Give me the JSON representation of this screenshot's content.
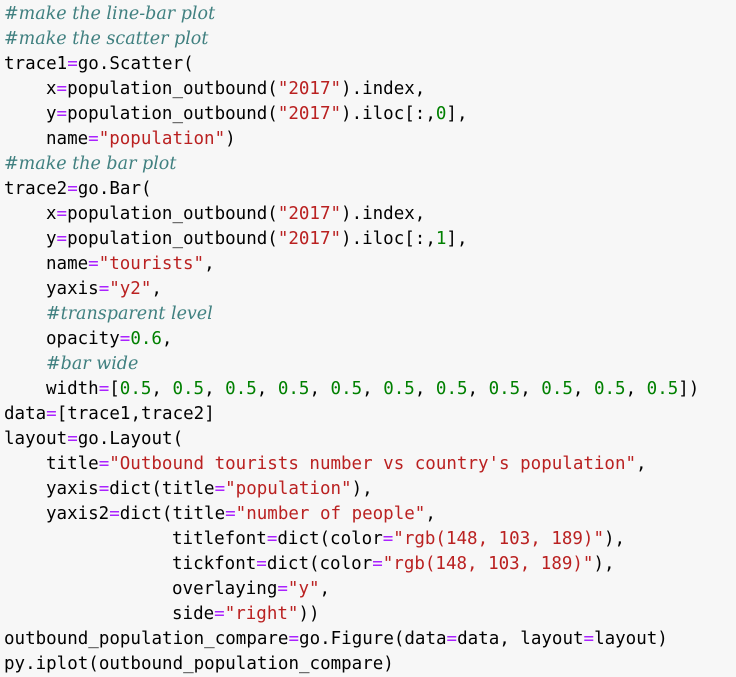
{
  "code_lines": [
    {
      "indent": 0,
      "parts": [
        {
          "t": "c",
          "v": "#make the line-bar plot"
        }
      ]
    },
    {
      "indent": 0,
      "parts": [
        {
          "t": "c",
          "v": "#make the scatter plot"
        }
      ]
    },
    {
      "indent": 0,
      "parts": [
        {
          "t": "k",
          "v": "trace1"
        },
        {
          "t": "o",
          "v": "="
        },
        {
          "t": "k",
          "v": "go.Scatter("
        }
      ]
    },
    {
      "indent": 1,
      "parts": [
        {
          "t": "k",
          "v": "x"
        },
        {
          "t": "o",
          "v": "="
        },
        {
          "t": "k",
          "v": "population_outbound("
        },
        {
          "t": "s",
          "v": "\"2017\""
        },
        {
          "t": "k",
          "v": ").index,"
        }
      ]
    },
    {
      "indent": 1,
      "parts": [
        {
          "t": "k",
          "v": "y"
        },
        {
          "t": "o",
          "v": "="
        },
        {
          "t": "k",
          "v": "population_outbound("
        },
        {
          "t": "s",
          "v": "\"2017\""
        },
        {
          "t": "k",
          "v": ").iloc[:,"
        },
        {
          "t": "n",
          "v": "0"
        },
        {
          "t": "k",
          "v": "],"
        }
      ]
    },
    {
      "indent": 1,
      "parts": [
        {
          "t": "k",
          "v": "name"
        },
        {
          "t": "o",
          "v": "="
        },
        {
          "t": "s",
          "v": "\"population\""
        },
        {
          "t": "k",
          "v": ")"
        }
      ]
    },
    {
      "indent": 0,
      "parts": [
        {
          "t": "c",
          "v": "#make the bar plot"
        }
      ]
    },
    {
      "indent": 0,
      "parts": [
        {
          "t": "k",
          "v": "trace2"
        },
        {
          "t": "o",
          "v": "="
        },
        {
          "t": "k",
          "v": "go.Bar("
        }
      ]
    },
    {
      "indent": 1,
      "parts": [
        {
          "t": "k",
          "v": "x"
        },
        {
          "t": "o",
          "v": "="
        },
        {
          "t": "k",
          "v": "population_outbound("
        },
        {
          "t": "s",
          "v": "\"2017\""
        },
        {
          "t": "k",
          "v": ").index,"
        }
      ]
    },
    {
      "indent": 1,
      "parts": [
        {
          "t": "k",
          "v": "y"
        },
        {
          "t": "o",
          "v": "="
        },
        {
          "t": "k",
          "v": "population_outbound("
        },
        {
          "t": "s",
          "v": "\"2017\""
        },
        {
          "t": "k",
          "v": ").iloc[:,"
        },
        {
          "t": "n",
          "v": "1"
        },
        {
          "t": "k",
          "v": "],"
        }
      ]
    },
    {
      "indent": 1,
      "parts": [
        {
          "t": "k",
          "v": "name"
        },
        {
          "t": "o",
          "v": "="
        },
        {
          "t": "s",
          "v": "\"tourists\""
        },
        {
          "t": "k",
          "v": ","
        }
      ]
    },
    {
      "indent": 1,
      "parts": [
        {
          "t": "k",
          "v": "yaxis"
        },
        {
          "t": "o",
          "v": "="
        },
        {
          "t": "s",
          "v": "\"y2\""
        },
        {
          "t": "k",
          "v": ","
        }
      ]
    },
    {
      "indent": 1,
      "parts": [
        {
          "t": "c",
          "v": "#transparent level"
        }
      ]
    },
    {
      "indent": 1,
      "parts": [
        {
          "t": "k",
          "v": "opacity"
        },
        {
          "t": "o",
          "v": "="
        },
        {
          "t": "n",
          "v": "0.6"
        },
        {
          "t": "k",
          "v": ","
        }
      ]
    },
    {
      "indent": 1,
      "parts": [
        {
          "t": "c",
          "v": "#bar wide"
        }
      ]
    },
    {
      "indent": 1,
      "parts": [
        {
          "t": "k",
          "v": "width"
        },
        {
          "t": "o",
          "v": "="
        },
        {
          "t": "k",
          "v": "["
        },
        {
          "t": "n",
          "v": "0.5"
        },
        {
          "t": "k",
          "v": ", "
        },
        {
          "t": "n",
          "v": "0.5"
        },
        {
          "t": "k",
          "v": ", "
        },
        {
          "t": "n",
          "v": "0.5"
        },
        {
          "t": "k",
          "v": ", "
        },
        {
          "t": "n",
          "v": "0.5"
        },
        {
          "t": "k",
          "v": ", "
        },
        {
          "t": "n",
          "v": "0.5"
        },
        {
          "t": "k",
          "v": ", "
        },
        {
          "t": "n",
          "v": "0.5"
        },
        {
          "t": "k",
          "v": ", "
        },
        {
          "t": "n",
          "v": "0.5"
        },
        {
          "t": "k",
          "v": ", "
        },
        {
          "t": "n",
          "v": "0.5"
        },
        {
          "t": "k",
          "v": ", "
        },
        {
          "t": "n",
          "v": "0.5"
        },
        {
          "t": "k",
          "v": ", "
        },
        {
          "t": "n",
          "v": "0.5"
        },
        {
          "t": "k",
          "v": ", "
        },
        {
          "t": "n",
          "v": "0.5"
        },
        {
          "t": "k",
          "v": "])"
        }
      ]
    },
    {
      "indent": 0,
      "parts": [
        {
          "t": "k",
          "v": "data"
        },
        {
          "t": "o",
          "v": "="
        },
        {
          "t": "k",
          "v": "[trace1,trace2]"
        }
      ]
    },
    {
      "indent": 0,
      "parts": [
        {
          "t": "k",
          "v": "layout"
        },
        {
          "t": "o",
          "v": "="
        },
        {
          "t": "k",
          "v": "go.Layout("
        }
      ]
    },
    {
      "indent": 1,
      "parts": [
        {
          "t": "k",
          "v": "title"
        },
        {
          "t": "o",
          "v": "="
        },
        {
          "t": "s",
          "v": "\"Outbound tourists number vs country's population\""
        },
        {
          "t": "k",
          "v": ","
        }
      ]
    },
    {
      "indent": 1,
      "parts": [
        {
          "t": "k",
          "v": "yaxis"
        },
        {
          "t": "o",
          "v": "="
        },
        {
          "t": "k",
          "v": "dict(title"
        },
        {
          "t": "o",
          "v": "="
        },
        {
          "t": "s",
          "v": "\"population\""
        },
        {
          "t": "k",
          "v": "),"
        }
      ]
    },
    {
      "indent": 1,
      "parts": [
        {
          "t": "k",
          "v": "yaxis2"
        },
        {
          "t": "o",
          "v": "="
        },
        {
          "t": "k",
          "v": "dict(title"
        },
        {
          "t": "o",
          "v": "="
        },
        {
          "t": "s",
          "v": "\"number of people\""
        },
        {
          "t": "k",
          "v": ","
        }
      ]
    },
    {
      "indent": 2,
      "parts": [
        {
          "t": "k",
          "v": "titlefont"
        },
        {
          "t": "o",
          "v": "="
        },
        {
          "t": "k",
          "v": "dict(color"
        },
        {
          "t": "o",
          "v": "="
        },
        {
          "t": "s",
          "v": "\"rgb(148, 103, 189)\""
        },
        {
          "t": "k",
          "v": "),"
        }
      ]
    },
    {
      "indent": 2,
      "parts": [
        {
          "t": "k",
          "v": "tickfont"
        },
        {
          "t": "o",
          "v": "="
        },
        {
          "t": "k",
          "v": "dict(color"
        },
        {
          "t": "o",
          "v": "="
        },
        {
          "t": "s",
          "v": "\"rgb(148, 103, 189)\""
        },
        {
          "t": "k",
          "v": "),"
        }
      ]
    },
    {
      "indent": 2,
      "parts": [
        {
          "t": "k",
          "v": "overlaying"
        },
        {
          "t": "o",
          "v": "="
        },
        {
          "t": "s",
          "v": "\"y\""
        },
        {
          "t": "k",
          "v": ","
        }
      ]
    },
    {
      "indent": 2,
      "parts": [
        {
          "t": "k",
          "v": "side"
        },
        {
          "t": "o",
          "v": "="
        },
        {
          "t": "s",
          "v": "\"right\""
        },
        {
          "t": "k",
          "v": "))"
        }
      ]
    },
    {
      "indent": 0,
      "parts": [
        {
          "t": "k",
          "v": "outbound_population_compare"
        },
        {
          "t": "o",
          "v": "="
        },
        {
          "t": "k",
          "v": "go.Figure(data"
        },
        {
          "t": "o",
          "v": "="
        },
        {
          "t": "k",
          "v": "data, layout"
        },
        {
          "t": "o",
          "v": "="
        },
        {
          "t": "k",
          "v": "layout)"
        }
      ]
    },
    {
      "indent": 0,
      "parts": [
        {
          "t": "k",
          "v": "py.iplot(outbound_population_compare)"
        }
      ]
    }
  ]
}
